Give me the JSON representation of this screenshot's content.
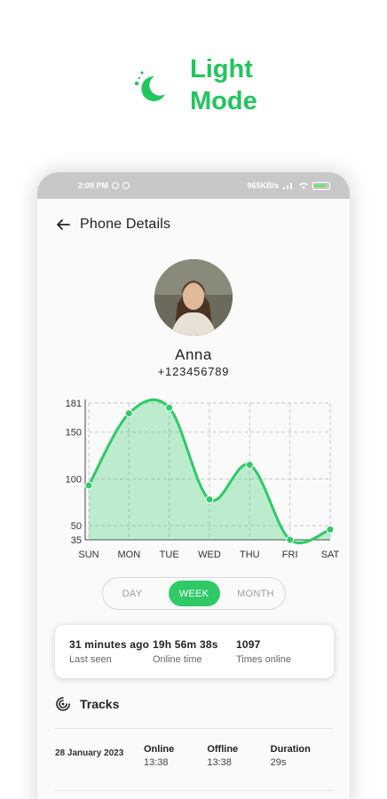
{
  "hero": {
    "title": "Light Mode",
    "accent": "#22c55e"
  },
  "status_bar": {
    "time": "2:09 PM",
    "speed": "965KB/s"
  },
  "header": {
    "title": "Phone Details"
  },
  "profile": {
    "name": "Anna",
    "phone": "+123456789"
  },
  "chart_data": {
    "type": "area",
    "categories": [
      "SUN",
      "MON",
      "TUE",
      "WED",
      "THU",
      "FRI",
      "SAT"
    ],
    "series": [
      {
        "values": [
          93,
          170,
          176,
          78,
          115,
          35,
          46
        ]
      }
    ],
    "yticks": [
      181,
      150,
      100,
      50,
      35
    ],
    "ylim": [
      35,
      181
    ],
    "grid": true,
    "color": "#2fca66"
  },
  "period_selector": {
    "options": [
      "DAY",
      "WEEK",
      "MONTH"
    ],
    "selected": "WEEK"
  },
  "stats": {
    "last_seen_value": "31 minutes ago",
    "last_seen_label": "Last seen",
    "online_time_value": "19h 56m 38s",
    "online_time_label": "Online time",
    "times_online_value": "1097",
    "times_online_label": "Times online"
  },
  "tracks": {
    "title": "Tracks",
    "rows": [
      {
        "date": "28 January 2023",
        "online_label": "Online",
        "online": "13:38",
        "offline_label": "Offline",
        "offline": "13:38",
        "duration_label": "Duration",
        "duration": "29s"
      }
    ]
  }
}
